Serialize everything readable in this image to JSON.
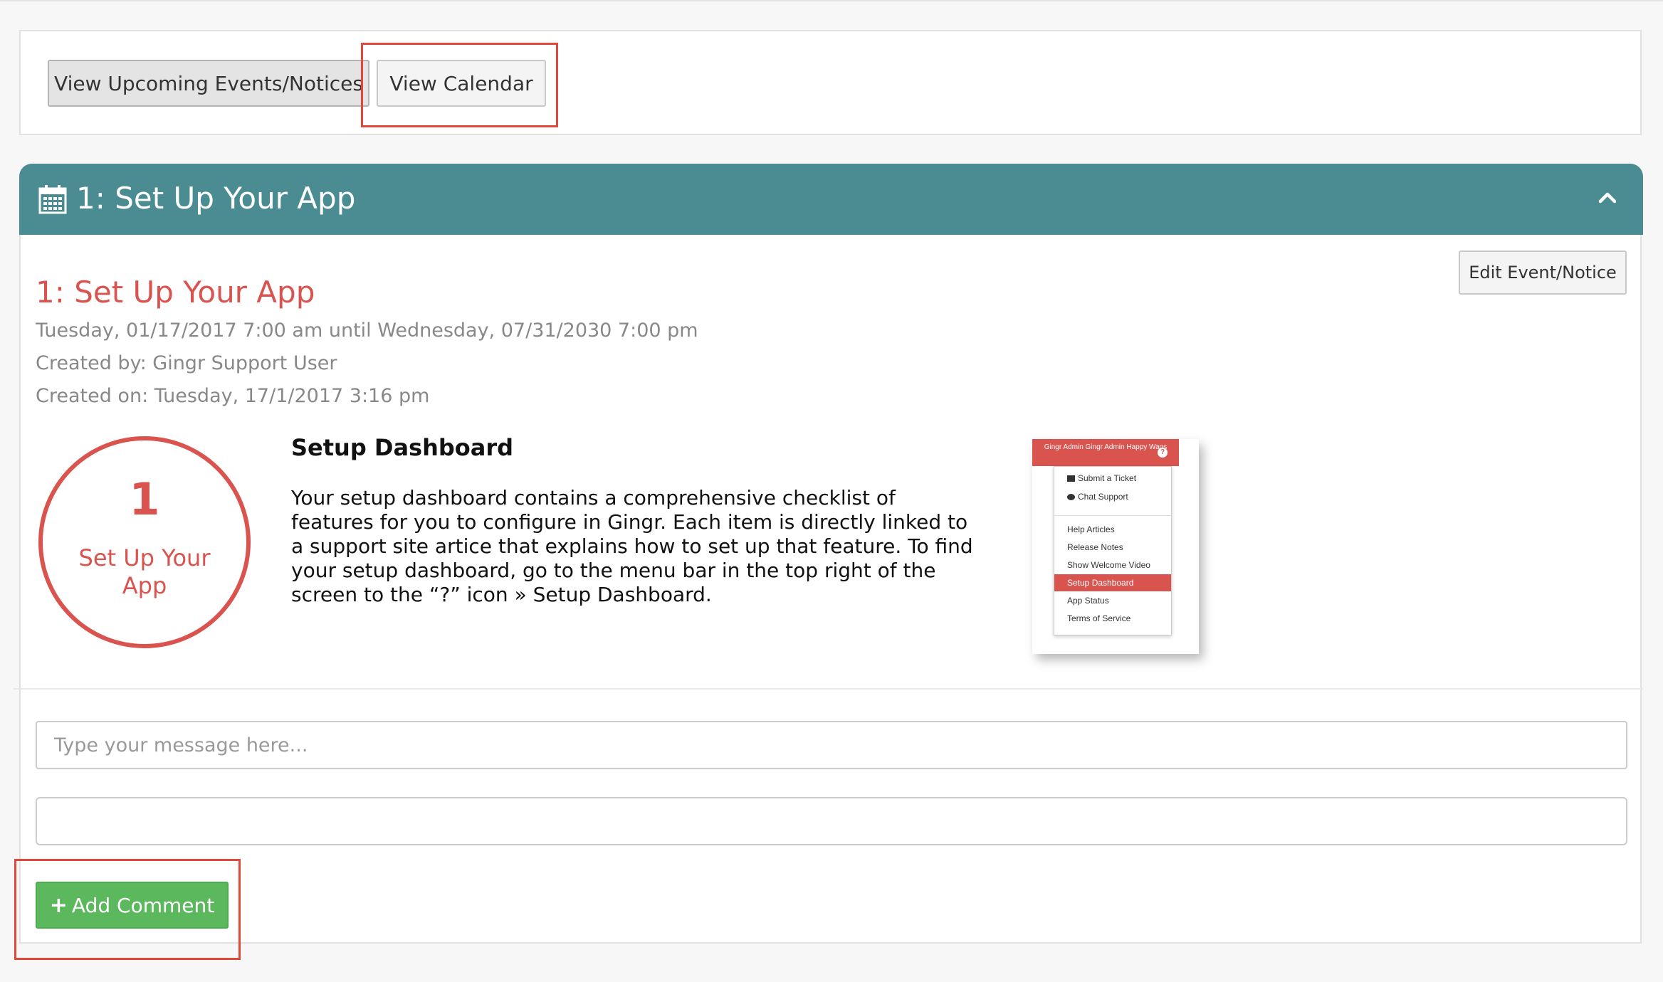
{
  "toolbar": {
    "upcoming_label": "View Upcoming Events/Notices",
    "calendar_label": "View Calendar"
  },
  "event_panel": {
    "header_title": "1: Set Up Your App",
    "header_color": "#4b8c92",
    "collapse_icon": "chevron-up-icon",
    "edit_label": "Edit Event/Notice",
    "title": "1: Set Up Your App",
    "date_range": "Tuesday, 01/17/2017 7:00 am until Wednesday, 07/31/2030 7:00 pm",
    "created_by": "Created by: Gingr Support User",
    "created_on": "Created on: Tuesday, 17/1/2017 3:16 pm",
    "accent_color": "#d9534f"
  },
  "step_badge": {
    "number": "1",
    "label": "Set Up Your App"
  },
  "content": {
    "heading": "Setup Dashboard",
    "body": "Your setup dashboard contains a comprehensive checklist of features for you to configure in Gingr. Each item is directly linked to a support site artice that explains how to set up that feature. To find your setup dashboard, go to the menu bar in the top right of the screen to the “?” icon » Setup Dashboard."
  },
  "mini_screenshot": {
    "header": "Gingr Admin Gingr Admin Happy Wags",
    "help_icon": "?",
    "items": [
      "Submit a Ticket",
      "Chat Support",
      "Help Articles",
      "Release Notes",
      "Show Welcome Video",
      "Setup Dashboard",
      "App Status",
      "Terms of Service"
    ],
    "active_item": "Setup Dashboard"
  },
  "comment": {
    "message_placeholder": "Type your message here...",
    "message_value": "",
    "add_label": "Add Comment",
    "add_color": "#5cb85c"
  },
  "highlight_color": "#e0493a"
}
